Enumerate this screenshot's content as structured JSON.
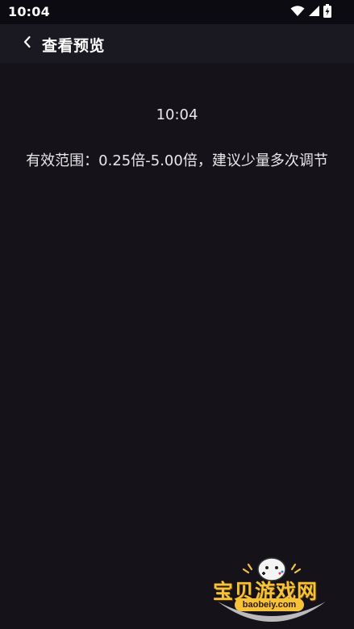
{
  "status_bar": {
    "time": "10:04",
    "icons": [
      "wifi-icon",
      "signal-icon",
      "battery-charging-icon"
    ]
  },
  "app_bar": {
    "title": "查看预览",
    "back_icon": "chevron-left-icon"
  },
  "preview": {
    "time": "10:04",
    "hint": "有效范围：0.25倍-5.00倍，建议少量多次调节"
  },
  "watermark": {
    "name": "宝贝游戏网",
    "url": "baobeiy.com"
  },
  "colors": {
    "background": "#15121a",
    "app_bar": "#1a1820",
    "text": "#e8e8e8",
    "watermark_gold": "#f6c23a"
  }
}
